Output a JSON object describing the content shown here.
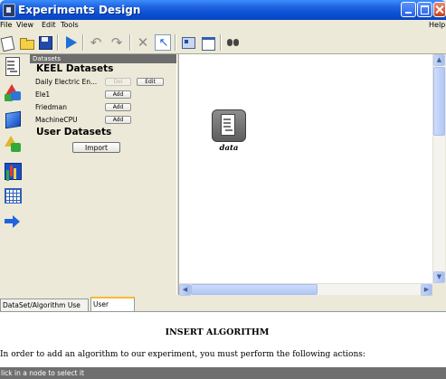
{
  "window": {
    "title": "Experiments Design"
  },
  "menu": {
    "items": [
      "File",
      "View",
      "Edit",
      "Tools",
      "Help"
    ]
  },
  "toolbar": {
    "icons": [
      "new-icon",
      "open-folder-icon",
      "save-icon",
      "run-icon",
      "undo-icon",
      "redo-icon",
      "delete-icon",
      "select-pointer-icon",
      "layout-icon",
      "window-icon",
      "binoculars-icon"
    ],
    "undo_glyph": "↶",
    "redo_glyph": "↷",
    "delete_glyph": "✕",
    "select_glyph": "↖"
  },
  "sidebar": {
    "icons": [
      "dataset-icon",
      "preprocess-icon",
      "method-icon",
      "postprocess-icon",
      "statistics-icon",
      "table-icon",
      "arrow-icon"
    ]
  },
  "datasets_panel": {
    "header": "Datasets",
    "keel_title": "KEEL Datasets",
    "keel_datasets": [
      {
        "name": "Daily Electric En...",
        "button": "Del",
        "button_enabled": false,
        "edit": "Edit"
      },
      {
        "name": "Ele1",
        "button": "Add"
      },
      {
        "name": "Friedman",
        "button": "Add"
      },
      {
        "name": "MachineCPU",
        "button": "Add"
      }
    ],
    "user_title": "User Datasets",
    "import_label": "Import"
  },
  "canvas": {
    "node_label": "data"
  },
  "scroll": {
    "up": "▲",
    "down": "▼",
    "left": "◀",
    "right": "▶"
  },
  "tabs": [
    {
      "label": "DataSet/Algorithm Use Case",
      "active": false
    },
    {
      "label": "User Manual",
      "active": true
    }
  ],
  "manual": {
    "heading": "INSERT ALGORITHM",
    "text": "In order to add an algorithm to our experiment, you must perform the following actions:"
  },
  "status": {
    "text": "lick in a node to select it"
  },
  "colors": {
    "titlebar": "#0a4fd4",
    "accent_tab": "#f9b934",
    "panel_header": "#6d6d6d",
    "statusbar": "#6f6f6f"
  }
}
